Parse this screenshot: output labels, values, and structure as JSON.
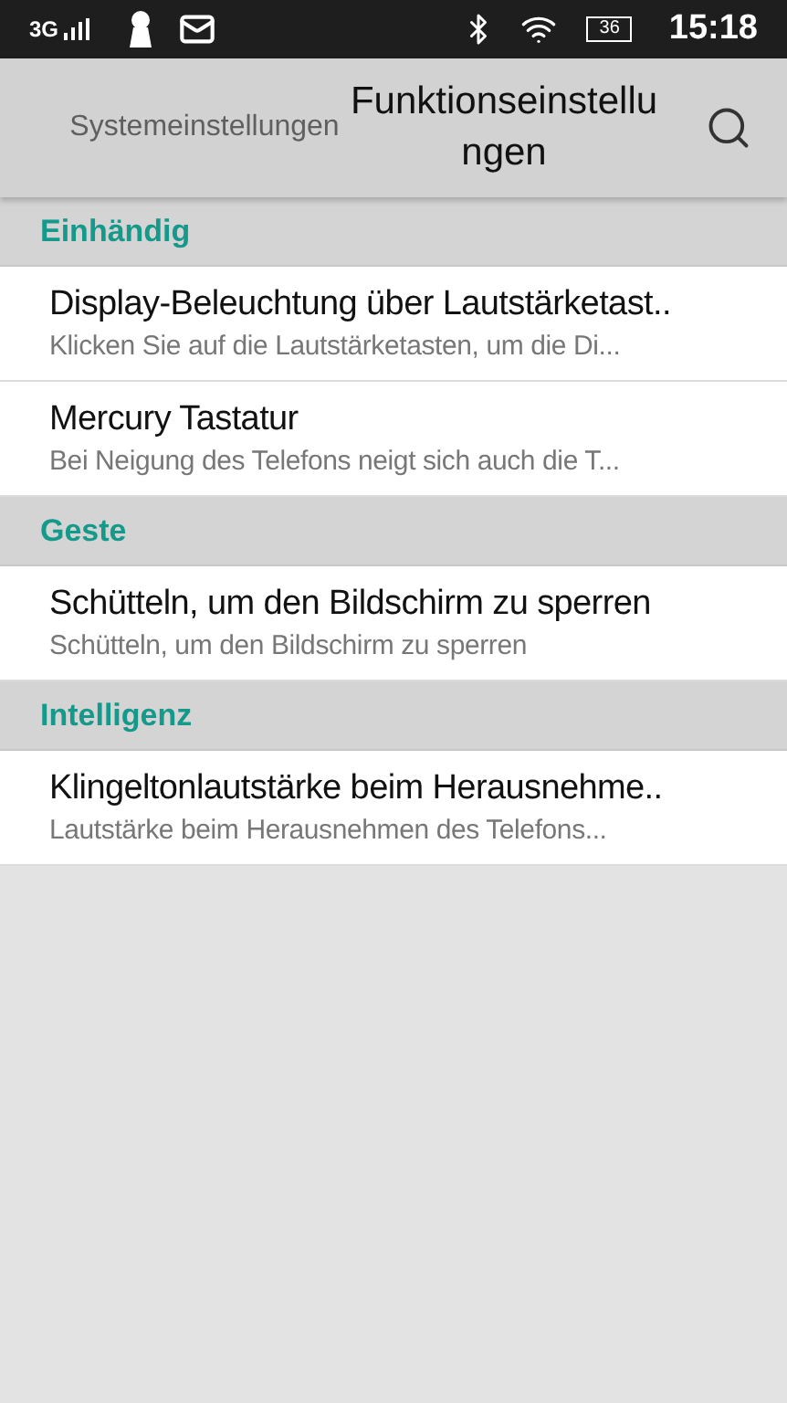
{
  "status_bar": {
    "network": "3G",
    "battery": "36",
    "time": "15:18"
  },
  "tabs": [
    {
      "label": "Systemeinstellungen",
      "selected": false
    },
    {
      "label": "Funktionseinstellungen",
      "selected": true
    }
  ],
  "sections": [
    {
      "title": "Einhändig",
      "items": [
        {
          "title": "Display-Beleuchtung über Lautstärketast..",
          "subtitle": "Klicken Sie auf die Lautstärketasten, um die Di..."
        },
        {
          "title": "Mercury Tastatur",
          "subtitle": "Bei Neigung des Telefons neigt sich auch die T..."
        }
      ]
    },
    {
      "title": "Geste",
      "items": [
        {
          "title": "Schütteln, um den Bildschirm zu sperren",
          "subtitle": "Schütteln, um den Bildschirm zu sperren"
        }
      ]
    },
    {
      "title": "Intelligenz",
      "items": [
        {
          "title": "Klingeltonlautstärke beim Herausnehme..",
          "subtitle": "Lautstärke beim Herausnehmen des Telefons..."
        }
      ]
    }
  ]
}
